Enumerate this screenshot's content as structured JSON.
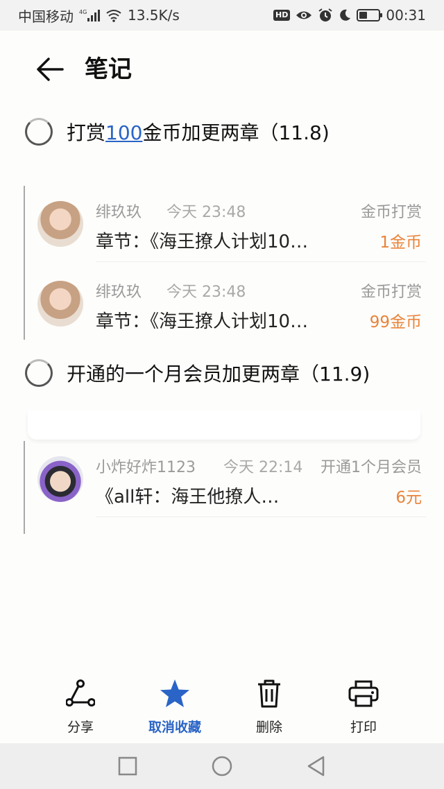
{
  "status_bar": {
    "carrier": "中国移动",
    "network": "4G",
    "speed": "13.5K/s",
    "hd_badge": "HD",
    "time": "00:31",
    "battery_level": 0.4
  },
  "header": {
    "title": "笔记"
  },
  "items": [
    {
      "text_before": "打赏",
      "link_text": "100",
      "text_after": "金币加更两章（11.8)",
      "records": [
        {
          "name": "绯玖玖",
          "time": "今天 23:48",
          "type": "金币打赏",
          "content": "章节：《海王撩人计划10…",
          "amount": "1金币"
        },
        {
          "name": "绯玖玖",
          "time": "今天 23:48",
          "type": "金币打赏",
          "content": "章节：《海王撩人计划10…",
          "amount": "99金币"
        }
      ]
    },
    {
      "text": "开通的一个月会员加更两章（11.9)",
      "records": [
        {
          "name": "小炸好炸1123",
          "time": "今天 22:14",
          "type": "开通1个月会员",
          "content": "《all轩：海王他撩人…",
          "amount": "6元"
        }
      ]
    }
  ],
  "toolbar": {
    "share_label": "分享",
    "unfavorite_label": "取消收藏",
    "delete_label": "删除",
    "print_label": "打印"
  },
  "colors": {
    "accent": "#2a64c7",
    "amount": "#e9833a",
    "muted": "#9a9a9a"
  }
}
